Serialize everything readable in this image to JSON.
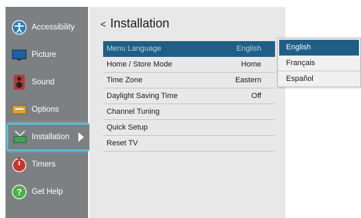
{
  "sidebar": {
    "items": [
      {
        "label": "Accessibility",
        "icon": "accessibility-icon",
        "color": "#2a7fb8"
      },
      {
        "label": "Picture",
        "icon": "picture-icon",
        "color": "#1e5fa3"
      },
      {
        "label": "Sound",
        "icon": "speaker-icon",
        "color": "#b23a3a"
      },
      {
        "label": "Options",
        "icon": "options-icon",
        "color": "#d9a23b"
      },
      {
        "label": "Installation",
        "icon": "antenna-icon",
        "color": "#3fa35a",
        "selected": true
      },
      {
        "label": "Timers",
        "icon": "timer-icon",
        "color": "#c9342f"
      },
      {
        "label": "Get Help",
        "icon": "help-icon",
        "color": "#4bb04a"
      }
    ]
  },
  "panel": {
    "back_glyph": "<",
    "title": "Installation",
    "rows": [
      {
        "label": "Menu Language",
        "value": "English",
        "selected": true
      },
      {
        "label": "Home / Store Mode",
        "value": "Home"
      },
      {
        "label": "Time Zone",
        "value": "Eastern"
      },
      {
        "label": "Daylight Saving Time",
        "value": "Off"
      },
      {
        "label": "Channel Tuning",
        "value": ""
      },
      {
        "label": "Quick Setup",
        "value": ""
      },
      {
        "label": "Reset TV",
        "value": ""
      }
    ]
  },
  "dropdown": {
    "options": [
      "English",
      "Français",
      "Español"
    ],
    "selected": "English"
  },
  "colors": {
    "sidebar_bg": "#7c8082",
    "panel_bg": "#e8e8e8",
    "highlight": "#1f5f86",
    "focus_border": "#4fc3e8"
  }
}
